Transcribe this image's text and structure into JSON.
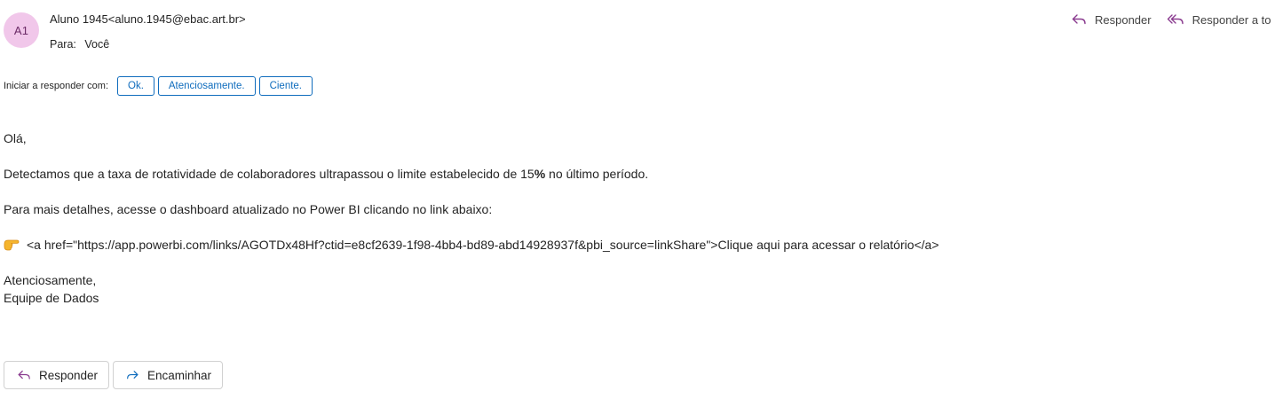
{
  "header": {
    "avatar_initials": "A1",
    "sender": "Aluno 1945<aluno.1945@ebac.art.br>",
    "to_label": "Para:",
    "to_value": "Você",
    "actions": {
      "reply_label": "Responder",
      "reply_all_label": "Responder a to"
    }
  },
  "quick_replies": {
    "label": "Iniciar a responder com:",
    "options": [
      "Ok.",
      "Atenciosamente.",
      "Ciente."
    ]
  },
  "body": {
    "greeting": "Olá,",
    "paragraph1_pre": "Detectamos que a taxa de rotatividade de colaboradores ultrapassou o limite estabelecido de 15",
    "paragraph1_bold": "%",
    "paragraph1_post": " no último período.",
    "paragraph2": "Para mais detalhes, acesse o dashboard atualizado no Power BI clicando no link abaixo:",
    "emoji": "👉",
    "link_text": "<a href=\"https://app.powerbi.com/links/AGOTDx48Hf?ctid=e8cf2639-1f98-4bb4-bd89-abd14928937f&pbi_source=linkShare\">Clique aqui para acessar o relatório</a>",
    "closing": "Atenciosamente,",
    "signature": "Equipe de Dados"
  },
  "footer": {
    "reply_label": "Responder",
    "forward_label": "Encaminhar"
  },
  "colors": {
    "accent": "#0f6cbd",
    "avatar_bg": "#f1c7ea",
    "icon_purple": "#8a3b8f",
    "icon_blue": "#0f6cbd"
  },
  "icons": {
    "reply": "reply-icon",
    "reply_all": "reply-all-icon",
    "forward": "forward-icon"
  }
}
